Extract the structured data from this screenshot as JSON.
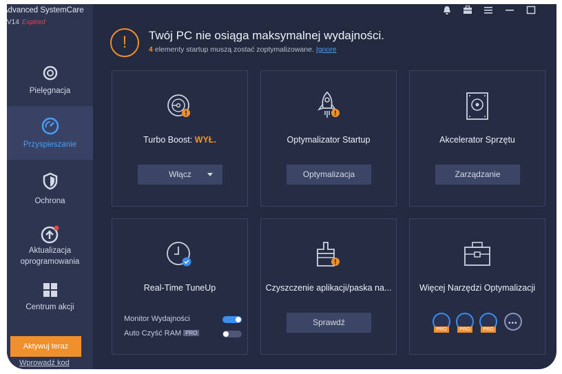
{
  "app": {
    "name": "Advanced SystemCare",
    "version": "V14",
    "status": "Expired"
  },
  "sidebar": {
    "items": [
      {
        "label": "Pielęgnacja",
        "icon": "gear-icon",
        "active": false
      },
      {
        "label": "Przyspieszanie",
        "icon": "speedometer-icon",
        "active": true
      },
      {
        "label": "Ochrona",
        "icon": "shield-icon",
        "active": false
      },
      {
        "label": "Aktualizacja oprogramowania",
        "icon": "update-arrow-icon",
        "active": false
      },
      {
        "label": "Centrum akcji",
        "icon": "grid-icon",
        "active": false
      }
    ],
    "activate_label": "Aktywuj teraz",
    "code_link": "Wprowadź kod"
  },
  "topbar": {
    "icons": [
      "bell-icon",
      "toolbox-icon",
      "menu-icon",
      "minimize-icon",
      "maximize-icon"
    ]
  },
  "alert": {
    "title": "Twój PC nie osiąga maksymalnej wydajności.",
    "count": "4",
    "message": " elementy startup muszą zostać zoptymalizowane. ",
    "ignore_link": "Ignore"
  },
  "cards": {
    "turbo": {
      "title": "Turbo Boost:",
      "state": "WYŁ.",
      "button": "Włącz"
    },
    "startup": {
      "title": "Optymalizator Startup",
      "button": "Optymalizacja"
    },
    "hardware": {
      "title": "Akcelerator Sprzętu",
      "button": "Zarządzanie"
    },
    "realtime": {
      "title": "Real-Time TuneUp",
      "toggles": [
        {
          "label": "Monitor Wydajności",
          "on": true,
          "pro": false
        },
        {
          "label": "Auto Czyść RAM",
          "on": false,
          "pro": true
        }
      ],
      "pro_label": "PRO"
    },
    "cleanup": {
      "title": "Czyszczenie aplikacji/paska na...",
      "button": "Sprawdź"
    },
    "more": {
      "title": "Więcej Narzędzi Optymalizacji",
      "tools": [
        "ram-chip-icon",
        "internet-booster-icon",
        "app-manager-icon",
        "more-dots-icon"
      ],
      "pro_label": "PRO",
      "more_label": "•••"
    }
  },
  "colors": {
    "accent_orange": "#f0902d",
    "accent_blue": "#3b8ff0",
    "background": "#232a40",
    "sidebar": "#2d3550"
  }
}
